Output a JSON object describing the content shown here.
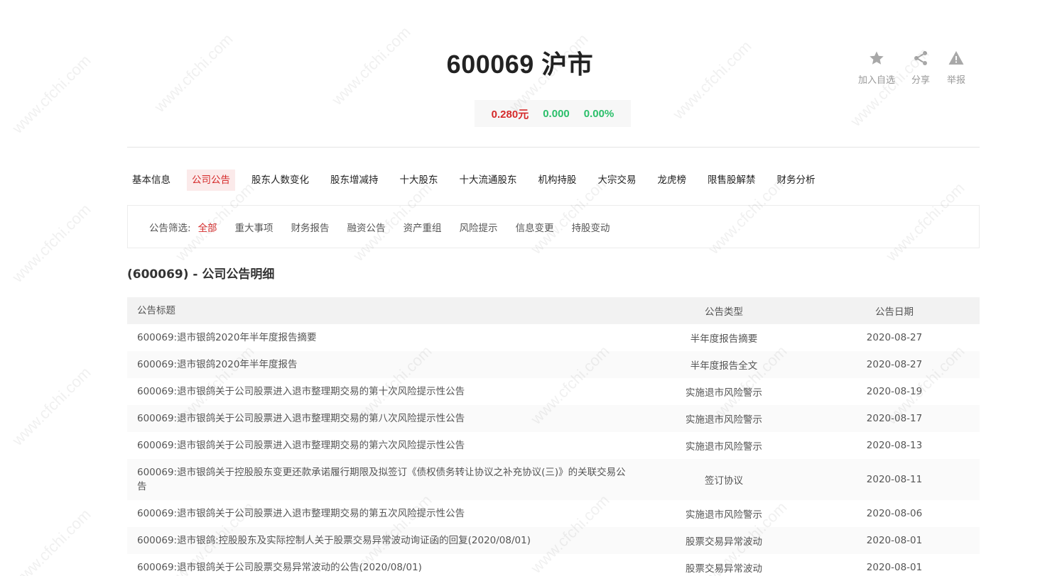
{
  "stock": {
    "title": "600069 沪市",
    "price": "0.280元",
    "change": "0.000",
    "change_pct": "0.00%"
  },
  "actions": {
    "favorite": "加入自选",
    "share": "分享",
    "report": "举报"
  },
  "tabs": [
    {
      "label": "基本信息",
      "active": false
    },
    {
      "label": "公司公告",
      "active": true
    },
    {
      "label": "股东人数变化",
      "active": false
    },
    {
      "label": "股东增减持",
      "active": false
    },
    {
      "label": "十大股东",
      "active": false
    },
    {
      "label": "十大流通股东",
      "active": false
    },
    {
      "label": "机构持股",
      "active": false
    },
    {
      "label": "大宗交易",
      "active": false
    },
    {
      "label": "龙虎榜",
      "active": false
    },
    {
      "label": "限售股解禁",
      "active": false
    },
    {
      "label": "财务分析",
      "active": false
    }
  ],
  "filter": {
    "label": "公告筛选:",
    "items": [
      {
        "label": "全部",
        "active": true
      },
      {
        "label": "重大事项",
        "active": false
      },
      {
        "label": "财务报告",
        "active": false
      },
      {
        "label": "融资公告",
        "active": false
      },
      {
        "label": "资产重组",
        "active": false
      },
      {
        "label": "风险提示",
        "active": false
      },
      {
        "label": "信息变更",
        "active": false
      },
      {
        "label": "持股变动",
        "active": false
      }
    ]
  },
  "section_title": "(600069) - 公司公告明细",
  "table": {
    "headers": {
      "title": "公告标题",
      "type": "公告类型",
      "date": "公告日期"
    },
    "rows": [
      {
        "title": "600069:退市银鸽2020年半年度报告摘要",
        "type": "半年度报告摘要",
        "date": "2020-08-27"
      },
      {
        "title": "600069:退市银鸽2020年半年度报告",
        "type": "半年度报告全文",
        "date": "2020-08-27"
      },
      {
        "title": "600069:退市银鸽关于公司股票进入退市整理期交易的第十次风险提示性公告",
        "type": "实施退市风险警示",
        "date": "2020-08-19"
      },
      {
        "title": "600069:退市银鸽关于公司股票进入退市整理期交易的第八次风险提示性公告",
        "type": "实施退市风险警示",
        "date": "2020-08-17"
      },
      {
        "title": "600069:退市银鸽关于公司股票进入退市整理期交易的第六次风险提示性公告",
        "type": "实施退市风险警示",
        "date": "2020-08-13"
      },
      {
        "title": "600069:退市银鸽关于控股股东变更还款承诺履行期限及拟签订《债权债务转让协议之补充协议(三)》的关联交易公告",
        "type": "签订协议",
        "date": "2020-08-11"
      },
      {
        "title": "600069:退市银鸽关于公司股票进入退市整理期交易的第五次风险提示性公告",
        "type": "实施退市风险警示",
        "date": "2020-08-06"
      },
      {
        "title": "600069:退市银鸽:控股股东及实际控制人关于股票交易异常波动询证函的回复(2020/08/01)",
        "type": "股票交易异常波动",
        "date": "2020-08-01"
      },
      {
        "title": "600069:退市银鸽关于公司股票交易异常波动的公告(2020/08/01)",
        "type": "股票交易异常波动",
        "date": "2020-08-01"
      }
    ]
  },
  "watermark_text": "www.cfchi.com"
}
